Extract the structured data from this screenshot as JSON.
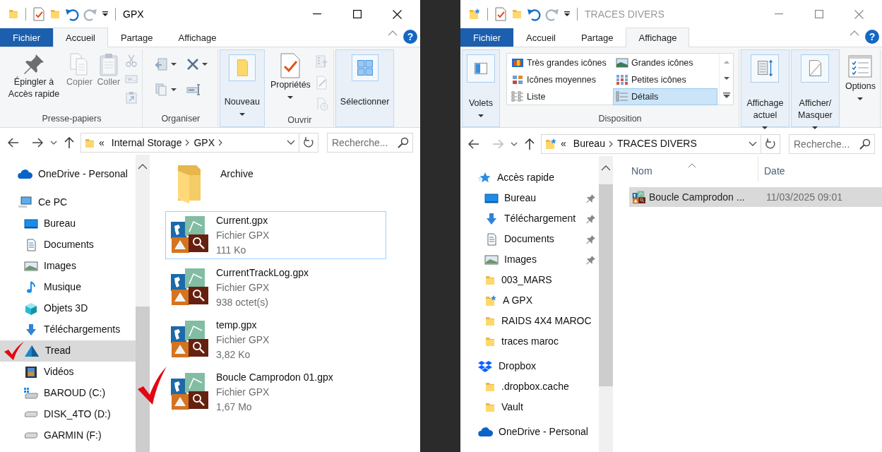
{
  "windows": [
    {
      "active": true,
      "title": "GPX",
      "ribbon_tabs": [
        {
          "label": "Fichier",
          "kind": "file",
          "selected": false
        },
        {
          "label": "Accueil",
          "kind": "tab",
          "selected": true
        },
        {
          "label": "Partage",
          "kind": "tab",
          "selected": false
        },
        {
          "label": "Affichage",
          "kind": "tab",
          "selected": false
        }
      ],
      "help": "?",
      "ribbon_groups": [
        {
          "label": "Presse-papiers",
          "highlighted": false,
          "items": [
            {
              "kind": "large",
              "label": "Épingler à Accès rapide",
              "dropdown": false,
              "disabled": false
            },
            {
              "kind": "large",
              "label": "Copier",
              "dropdown": false,
              "disabled": true
            },
            {
              "kind": "large",
              "label": "Coller",
              "dropdown": false,
              "disabled": true
            },
            {
              "kind": "stack",
              "disabled": true
            }
          ]
        },
        {
          "label": "Organiser",
          "highlighted": false,
          "items": [
            {
              "kind": "grid"
            }
          ]
        },
        {
          "highlighted": true,
          "items": [
            {
              "kind": "large",
              "label": "Nouveau",
              "dropdown": true,
              "disabled": false
            }
          ]
        },
        {
          "label": "Ouvrir",
          "highlighted": false,
          "items": [
            {
              "kind": "large",
              "label": "Propriétés",
              "dropdown": true,
              "disabled": false
            },
            {
              "kind": "stack",
              "disabled": true
            }
          ]
        },
        {
          "highlighted": true,
          "items": [
            {
              "kind": "large",
              "label": "Sélectionner",
              "dropdown": false,
              "disabled": false
            }
          ]
        }
      ],
      "address": {
        "overflow": "«",
        "crumbs": [
          "Internal Storage",
          "GPX"
        ],
        "trailing_separator": true
      },
      "forward_enabled": true,
      "search": {
        "placeholder": "Recherche..."
      },
      "nav": [
        {
          "kind": "cloud",
          "label": "OneDrive - Personal",
          "selected": false,
          "checkmark": false
        },
        {
          "kind": "pc",
          "label": "Ce PC",
          "selected": false,
          "checkmark": false,
          "children": [
            {
              "kind": "desktop",
              "label": "Bureau",
              "selected": false,
              "checkmark": false
            },
            {
              "kind": "documents",
              "label": "Documents",
              "selected": false,
              "checkmark": false
            },
            {
              "kind": "images",
              "label": "Images",
              "selected": false,
              "checkmark": false
            },
            {
              "kind": "music",
              "label": "Musique",
              "selected": false,
              "checkmark": false
            },
            {
              "kind": "cube",
              "label": "Objets 3D",
              "selected": false,
              "checkmark": false
            },
            {
              "kind": "downloads",
              "label": "Téléchargements",
              "selected": false,
              "checkmark": false
            },
            {
              "kind": "tread",
              "label": "Tread",
              "selected": true,
              "checkmark": true
            },
            {
              "kind": "videos",
              "label": "Vidéos",
              "selected": false,
              "checkmark": false
            },
            {
              "kind": "system-drive",
              "label": "BAROUD (C:)",
              "selected": false,
              "checkmark": false
            },
            {
              "kind": "drive",
              "label": "DISK_4TO (D:)",
              "selected": false,
              "checkmark": false
            },
            {
              "kind": "drive",
              "label": "GARMIN (F:)",
              "selected": false,
              "checkmark": false
            }
          ]
        }
      ],
      "files": [
        {
          "kind": "folder",
          "name": "Archive",
          "focused": false,
          "checkmark": false
        },
        {
          "kind": "gpx",
          "name": "Current.gpx",
          "type": "Fichier GPX",
          "size": "111 Ko",
          "focused": true,
          "checkmark": false
        },
        {
          "kind": "gpx",
          "name": "CurrentTrackLog.gpx",
          "type": "Fichier GPX",
          "size": "938 octet(s)",
          "focused": false,
          "checkmark": false
        },
        {
          "kind": "gpx",
          "name": "temp.gpx",
          "type": "Fichier GPX",
          "size": "3,82 Ko",
          "focused": false,
          "checkmark": false
        },
        {
          "kind": "gpx",
          "name": "Boucle Camprodon 01.gpx",
          "type": "Fichier GPX",
          "size": "1,67 Mo",
          "focused": false,
          "checkmark": true
        }
      ]
    },
    {
      "active": false,
      "title": "TRACES DIVERS",
      "ribbon_tabs": [
        {
          "label": "Fichier",
          "kind": "file",
          "selected": false
        },
        {
          "label": "Accueil",
          "kind": "tab",
          "selected": false
        },
        {
          "label": "Partage",
          "kind": "tab",
          "selected": false
        },
        {
          "label": "Affichage",
          "kind": "tab",
          "selected": true
        }
      ],
      "help": "?",
      "ribbon_groups": [
        {
          "highlighted": true,
          "items": [
            {
              "kind": "large",
              "label": "Volets",
              "dropdown": true,
              "disabled": false
            }
          ]
        },
        {
          "label": "Disposition",
          "highlighted": false,
          "items": [
            {
              "kind": "gallery",
              "options": [
                {
                  "label": "Très grandes icônes",
                  "selected": false
                },
                {
                  "label": "Grandes icônes",
                  "selected": false
                },
                {
                  "label": "Icônes moyennes",
                  "selected": false
                },
                {
                  "label": "Petites icônes",
                  "selected": false
                },
                {
                  "label": "Liste",
                  "selected": false
                },
                {
                  "label": "Détails",
                  "selected": true
                }
              ]
            }
          ]
        },
        {
          "highlighted": true,
          "items": [
            {
              "kind": "large",
              "label": "Affichage actuel",
              "dropdown": true,
              "disabled": false
            }
          ]
        },
        {
          "highlighted": true,
          "items": [
            {
              "kind": "large",
              "label": "Afficher/ Masquer",
              "dropdown": true,
              "disabled": false
            }
          ]
        },
        {
          "highlighted": false,
          "items": [
            {
              "kind": "large",
              "label": "Options",
              "dropdown": true,
              "disabled": false
            }
          ]
        }
      ],
      "address": {
        "overflow": "«",
        "crumbs": [
          "Bureau",
          "TRACES DIVERS"
        ],
        "trailing_separator": false
      },
      "forward_enabled": false,
      "search": {
        "placeholder": "Recherche..."
      },
      "nav": [
        {
          "kind": "star",
          "label": "Accès rapide",
          "selected": false,
          "pinned": false,
          "children": [
            {
              "kind": "desktop",
              "label": "Bureau",
              "selected": false,
              "pinned": true
            },
            {
              "kind": "downloads",
              "label": "Téléchargement",
              "selected": false,
              "pinned": true
            },
            {
              "kind": "documents",
              "label": "Documents",
              "selected": false,
              "pinned": true
            },
            {
              "kind": "images",
              "label": "Images",
              "selected": false,
              "pinned": true
            },
            {
              "kind": "folder",
              "label": "003_MARS",
              "selected": false,
              "pinned": false
            },
            {
              "kind": "folder-star",
              "label": "A GPX",
              "selected": false,
              "pinned": false
            },
            {
              "kind": "folder",
              "label": "RAIDS 4X4 MAROC",
              "selected": false,
              "pinned": false
            },
            {
              "kind": "folder",
              "label": "traces maroc",
              "selected": false,
              "pinned": false
            }
          ]
        },
        {
          "kind": "dropbox",
          "label": "Dropbox",
          "selected": false,
          "pinned": false,
          "children": [
            {
              "kind": "folder",
              "label": ".dropbox.cache",
              "selected": false,
              "pinned": false
            },
            {
              "kind": "folder",
              "label": "Vault",
              "selected": false,
              "pinned": false
            }
          ]
        },
        {
          "kind": "cloud",
          "label": "OneDrive - Personal",
          "selected": false,
          "pinned": false
        }
      ],
      "columns": [
        {
          "label": "Nom",
          "sorted": true
        },
        {
          "label": "Date",
          "sorted": false
        }
      ],
      "rows": [
        {
          "name": "Boucle Camprodon ...",
          "date": "11/03/2025 09:01",
          "selected": true
        }
      ]
    }
  ]
}
